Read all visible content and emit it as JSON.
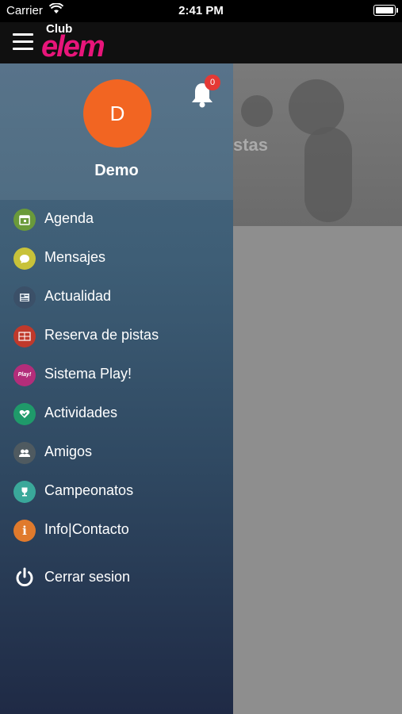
{
  "status_bar": {
    "carrier": "Carrier",
    "time": "2:41 PM"
  },
  "header": {
    "logo_top": "Club",
    "logo_main": "elem"
  },
  "background": {
    "partial_text": "stas"
  },
  "drawer": {
    "avatar_letter": "D",
    "username": "Demo",
    "notification_count": "0",
    "menu": [
      {
        "label": "Agenda",
        "icon": "calendar-icon",
        "color": "#6a9a3a"
      },
      {
        "label": "Mensajes",
        "icon": "chat-icon",
        "color": "#c8c23a"
      },
      {
        "label": "Actualidad",
        "icon": "news-icon",
        "color": "#3b5068"
      },
      {
        "label": "Reserva de pistas",
        "icon": "court-icon",
        "color": "#c0392b"
      },
      {
        "label": "Sistema Play!",
        "icon": "play-icon",
        "color": "#b32d7a"
      },
      {
        "label": "Actividades",
        "icon": "heart-icon",
        "color": "#1f9a6a"
      },
      {
        "label": "Amigos",
        "icon": "friends-icon",
        "color": "#4f5a60"
      },
      {
        "label": "Campeonatos",
        "icon": "trophy-icon",
        "color": "#3aa89a"
      },
      {
        "label": "Info|Contacto",
        "icon": "info-icon",
        "color": "#e07a2c"
      }
    ],
    "logout_label": "Cerrar sesion"
  },
  "colors": {
    "brand": "#e8157a",
    "avatar": "#f26522",
    "badge": "#e53935"
  }
}
